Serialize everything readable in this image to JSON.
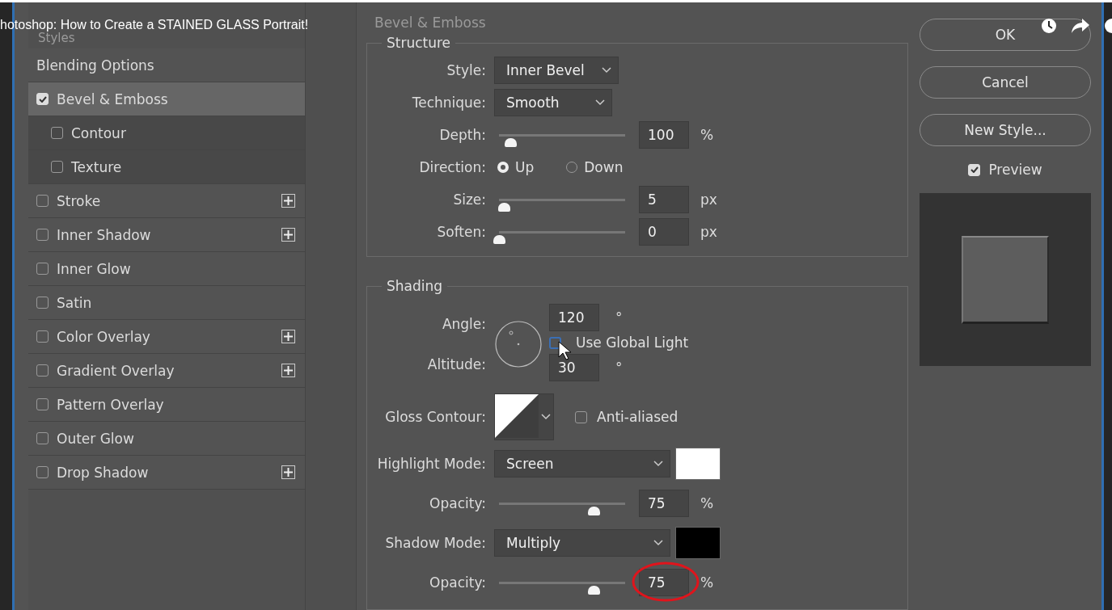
{
  "video_title": "hotoshop: How to Create a STAINED GLASS Portrait!",
  "styles_panel": {
    "header": "Styles",
    "items": [
      {
        "kind": "option",
        "label": "Blending Options",
        "selected": false
      },
      {
        "kind": "effect",
        "label": "Bevel & Emboss",
        "checked": true,
        "selected": true,
        "addable": false,
        "children": [
          {
            "kind": "effect",
            "label": "Contour",
            "checked": false,
            "selected": false,
            "addable": false
          },
          {
            "kind": "effect",
            "label": "Texture",
            "checked": false,
            "selected": false,
            "addable": false
          }
        ]
      },
      {
        "kind": "effect",
        "label": "Stroke",
        "checked": false,
        "selected": false,
        "addable": true
      },
      {
        "kind": "effect",
        "label": "Inner Shadow",
        "checked": false,
        "selected": false,
        "addable": true
      },
      {
        "kind": "effect",
        "label": "Inner Glow",
        "checked": false,
        "selected": false,
        "addable": false
      },
      {
        "kind": "effect",
        "label": "Satin",
        "checked": false,
        "selected": false,
        "addable": false
      },
      {
        "kind": "effect",
        "label": "Color Overlay",
        "checked": false,
        "selected": false,
        "addable": true
      },
      {
        "kind": "effect",
        "label": "Gradient Overlay",
        "checked": false,
        "selected": false,
        "addable": true
      },
      {
        "kind": "effect",
        "label": "Pattern Overlay",
        "checked": false,
        "selected": false,
        "addable": false
      },
      {
        "kind": "effect",
        "label": "Outer Glow",
        "checked": false,
        "selected": false,
        "addable": false
      },
      {
        "kind": "effect",
        "label": "Drop Shadow",
        "checked": false,
        "selected": false,
        "addable": true
      }
    ]
  },
  "section_title": "Bevel & Emboss",
  "structure": {
    "title": "Structure",
    "rows": [
      {
        "kind": "select",
        "label": "Style:",
        "value": "Inner Bevel"
      },
      {
        "kind": "select",
        "label": "Technique:",
        "value": "Smooth"
      },
      {
        "kind": "slider",
        "label": "Depth:",
        "level": 0.09,
        "value": "100",
        "unit": "%"
      },
      {
        "kind": "radio",
        "label": "Direction:",
        "options": [
          {
            "label": "Up",
            "selected": true
          },
          {
            "label": "Down",
            "selected": false
          }
        ]
      },
      {
        "kind": "slider",
        "label": "Size:",
        "level": 0.04,
        "value": "5",
        "unit": "px"
      },
      {
        "kind": "slider",
        "label": "Soften:",
        "level": 0,
        "value": "0",
        "unit": "px"
      }
    ]
  },
  "shading": {
    "title": "Shading",
    "angle": {
      "label": "Angle:",
      "value": "120",
      "unit": "°"
    },
    "use_global_light": {
      "label": "Use Global Light",
      "checked": false
    },
    "altitude": {
      "label": "Altitude:",
      "value": "30",
      "unit": "°"
    },
    "gloss_contour": {
      "label": "Gloss Contour:"
    },
    "anti_aliased": {
      "label": "Anti-aliased",
      "checked": false
    },
    "modes": [
      {
        "label": "Highlight Mode:",
        "value": "Screen",
        "color": "#ffffff",
        "opacity": {
          "label": "Opacity:",
          "level": 0.75,
          "value": "75",
          "unit": "%",
          "circled": false
        }
      },
      {
        "label": "Shadow Mode:",
        "value": "Multiply",
        "color": "#000000",
        "opacity": {
          "label": "Opacity:",
          "level": 0.75,
          "value": "75",
          "unit": "%",
          "circled": true
        }
      }
    ]
  },
  "buttons": [
    {
      "label": "OK"
    },
    {
      "label": "Cancel"
    },
    {
      "label": "New Style..."
    }
  ],
  "preview": {
    "label": "Preview",
    "checked": true
  }
}
